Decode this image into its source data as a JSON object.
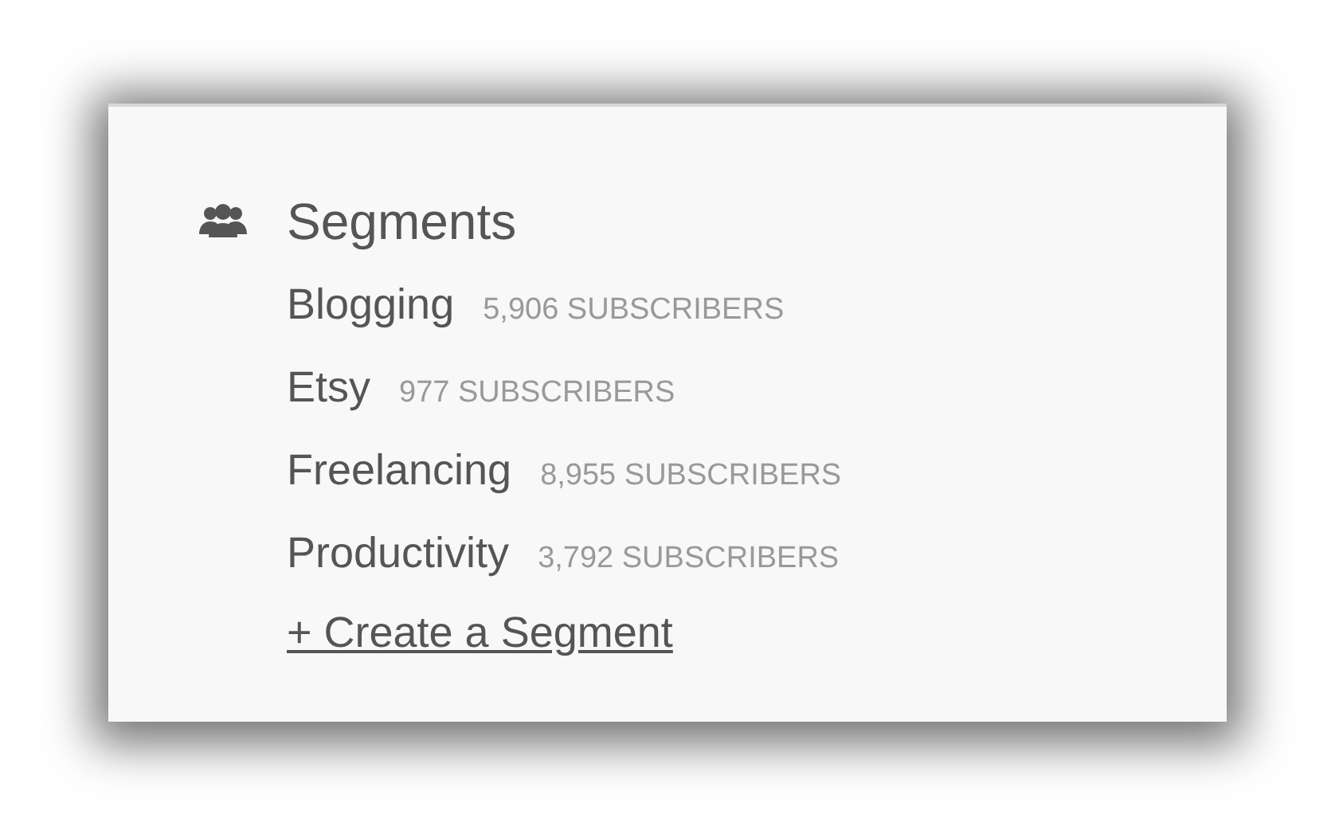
{
  "heading": "Segments",
  "segments": [
    {
      "name": "Blogging",
      "count": "5,906 SUBSCRIBERS"
    },
    {
      "name": "Etsy",
      "count": "977 SUBSCRIBERS"
    },
    {
      "name": "Freelancing",
      "count": "8,955 SUBSCRIBERS"
    },
    {
      "name": "Productivity",
      "count": "3,792 SUBSCRIBERS"
    }
  ],
  "create_link": "+ Create a Segment"
}
